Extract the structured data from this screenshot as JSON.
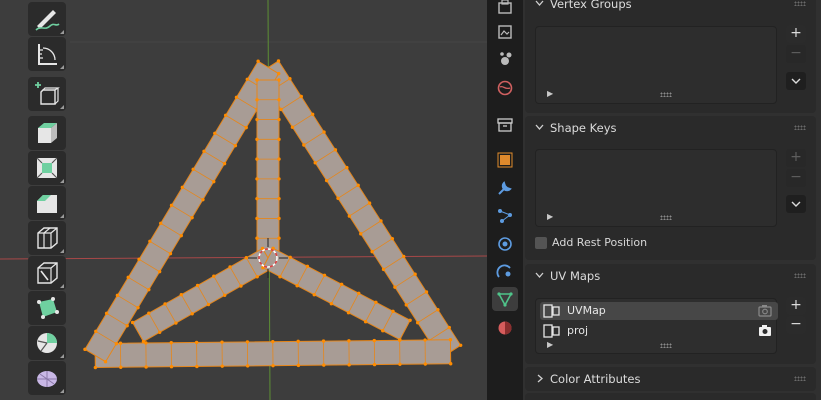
{
  "viewport": {
    "tools": [
      {
        "icon": "annotate-icon"
      },
      {
        "icon": "measure-icon"
      },
      {
        "icon": "add-cube-icon"
      },
      {
        "icon": "extrude-region-icon"
      },
      {
        "icon": "inset-faces-icon"
      },
      {
        "icon": "bevel-icon"
      },
      {
        "icon": "loop-cut-icon"
      },
      {
        "icon": "knife-icon"
      },
      {
        "icon": "poly-build-icon"
      },
      {
        "icon": "spin-icon"
      },
      {
        "icon": "smooth-vertices-icon"
      }
    ],
    "colors": {
      "background": "#3d3d3d",
      "mesh_face": "#a89c95",
      "mesh_edge": "#e6861a",
      "vertex": "#ff8c00",
      "axis_x": "#b04a4a",
      "axis_y": "#6a9a3a"
    }
  },
  "tabs": [
    {
      "icon": "tool-icon"
    },
    {
      "icon": "render-icon"
    },
    {
      "icon": "output-icon"
    },
    {
      "icon": "view-layer-icon"
    },
    {
      "icon": "scene-icon"
    },
    {
      "icon": "world-icon"
    },
    {
      "icon": "collection-icon"
    },
    {
      "icon": "object-icon"
    },
    {
      "icon": "modifier-icon"
    },
    {
      "icon": "particles-icon"
    },
    {
      "icon": "physics-icon"
    },
    {
      "icon": "constraints-icon"
    },
    {
      "icon": "data-icon",
      "active": true
    },
    {
      "icon": "material-icon"
    }
  ],
  "properties": {
    "vertex_groups": {
      "title": "Vertex Groups"
    },
    "shape_keys": {
      "title": "Shape Keys",
      "add_rest_position": "Add Rest Position",
      "add_rest_checked": false
    },
    "uv_maps": {
      "title": "UV Maps",
      "items": [
        {
          "name": "UVMap",
          "selected": true
        },
        {
          "name": "proj",
          "selected": false
        }
      ]
    },
    "color_attributes": {
      "title": "Color Attributes"
    }
  }
}
